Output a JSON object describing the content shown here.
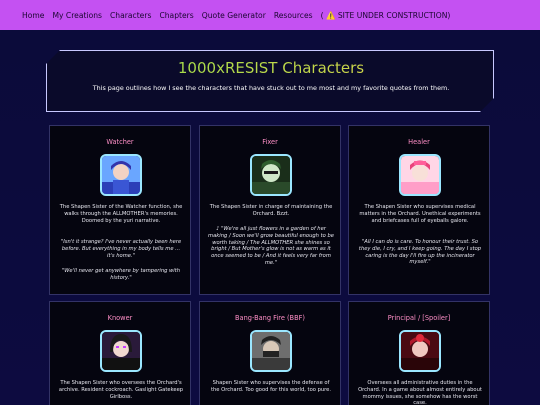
{
  "nav": {
    "home": "Home",
    "creations": "My Creations",
    "characters": "Characters",
    "chapters": "Chapters",
    "quote_generator": "Quote Generator",
    "resources": "Resources",
    "construction": "( ⚠️ SITE UNDER CONSTRUCTION)"
  },
  "header": {
    "title": "1000xRESIST Characters",
    "subtitle": "This page outlines how I see the characters that have stuck out to me most and my favorite quotes from them."
  },
  "cards": [
    {
      "name": "Watcher",
      "desc": "The Shapen Sister of the Watcher function, she walks through the ALLMOTHER's memories. Doomed by the yuri narrative.",
      "quote1": "\"Isn't it strange? I've never actually been here before. But everything in my body tells me ... it's home.\"",
      "quote2": "\"We'll never get anywhere by tampering with history.\""
    },
    {
      "name": "Fixer",
      "desc": "The Shapen Sister in charge of maintaining the Orchard. Bzzt.",
      "quote1": "♪ \"We're all just flowers in a garden of her making / Soon we'll grow beautiful enough to be worth taking / The ALLMOTHER she shines so bright / But Mother's glow is not as warm as it once seemed to be / And it feels very far from me.\"",
      "quote2": ""
    },
    {
      "name": "Healer",
      "desc": "The Shapen Sister who supervises medical matters in the Orchard. Unethical experiments and briefcases full of eyeballs galore.",
      "quote1": "\"All I can do is care. To honour their trust. So they die, I cry, and I keep going. The day I stop caring is the day I'll fire up the incinerator myself.\"",
      "quote2": ""
    },
    {
      "name": "Knower",
      "desc": "The Shapen Sister who oversees the Orchard's archive. Resident cockroach. Gaslight Gatekeep Girlboss.",
      "quote1": "",
      "quote2": ""
    },
    {
      "name": "Bang-Bang Fire (BBF)",
      "desc": "Shapen Sister who supervises the defense of the Orchard. Too good for this world, too pure.",
      "quote1": "",
      "quote2": ""
    },
    {
      "name": "Principal / [Spoiler]",
      "desc": "Oversees all administrative duties in the Orchard. In a game about almost entirely about mommy issues, she somehow has the worst case.",
      "quote1": "",
      "quote2": ""
    }
  ],
  "colors": {
    "navbar": "#c451f2",
    "background": "#0b0b3a",
    "name_pink": "#ff8fc7",
    "title_green": "#8de04a",
    "title_yellow": "#e8d14a"
  }
}
